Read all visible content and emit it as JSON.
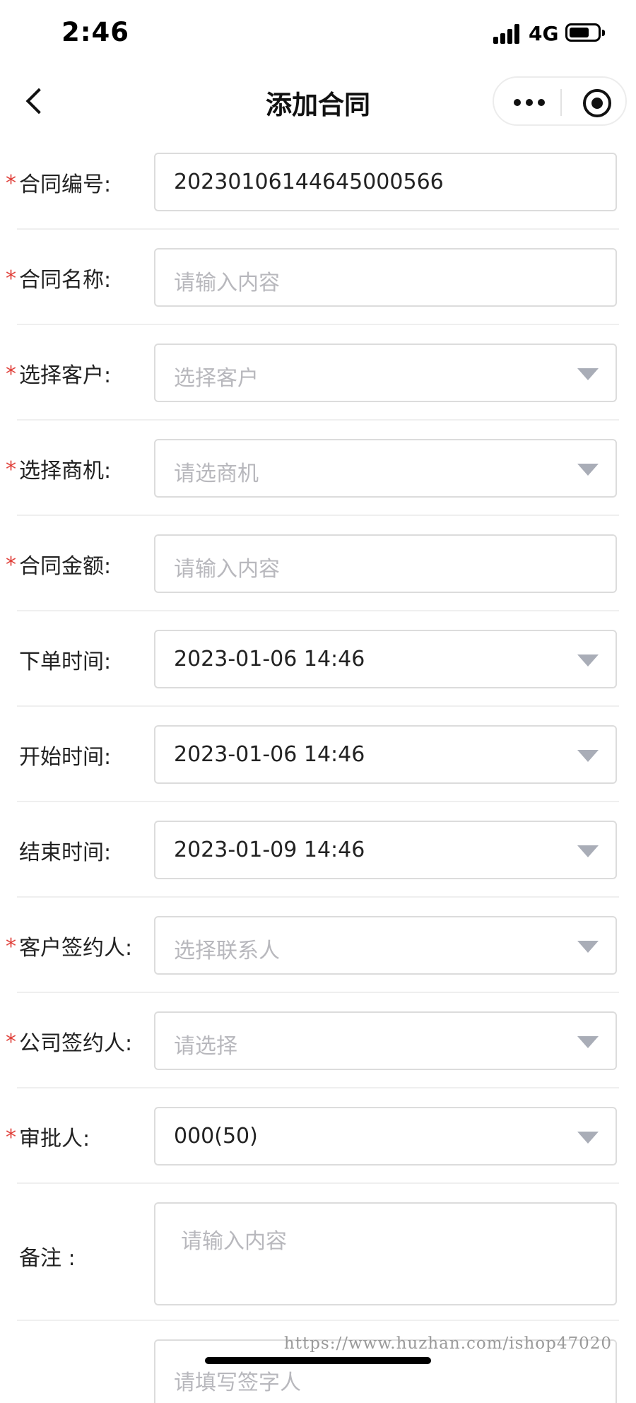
{
  "status_bar": {
    "time": "2:46",
    "network": "4G"
  },
  "nav": {
    "title": "添加合同"
  },
  "form": {
    "rows": [
      {
        "label": "合同编号:",
        "required": true,
        "value": "20230106144645000566",
        "is_placeholder": false,
        "dropdown": false
      },
      {
        "label": "合同名称:",
        "required": true,
        "value": "请输入内容",
        "is_placeholder": true,
        "dropdown": false
      },
      {
        "label": "选择客户:",
        "required": true,
        "value": "选择客户",
        "is_placeholder": true,
        "dropdown": true
      },
      {
        "label": "选择商机:",
        "required": true,
        "value": "请选商机",
        "is_placeholder": true,
        "dropdown": true
      },
      {
        "label": "合同金额:",
        "required": true,
        "value": "请输入内容",
        "is_placeholder": true,
        "dropdown": false
      },
      {
        "label": "下单时间:",
        "required": false,
        "value": "2023-01-06 14:46",
        "is_placeholder": false,
        "dropdown": true
      },
      {
        "label": "开始时间:",
        "required": false,
        "value": "2023-01-06 14:46",
        "is_placeholder": false,
        "dropdown": true
      },
      {
        "label": "结束时间:",
        "required": false,
        "value": "2023-01-09 14:46",
        "is_placeholder": false,
        "dropdown": true
      },
      {
        "label": "客户签约人:",
        "required": true,
        "value": "选择联系人",
        "is_placeholder": true,
        "dropdown": true
      },
      {
        "label": "公司签约人:",
        "required": true,
        "value": "请选择",
        "is_placeholder": true,
        "dropdown": true
      },
      {
        "label": "审批人:",
        "required": true,
        "value": "000(50)",
        "is_placeholder": false,
        "dropdown": true
      }
    ],
    "required_mark": "*",
    "remark": {
      "label": "备注 :",
      "placeholder": "请输入内容"
    },
    "signature": {
      "placeholder": "请填写签字人"
    }
  },
  "watermark": "https://www.huzhan.com/ishop47020",
  "colors": {
    "required": "#e0403a",
    "placeholder": "#b8b8bd",
    "arrow": "#a9adb7",
    "border": "#dcdcdc"
  }
}
